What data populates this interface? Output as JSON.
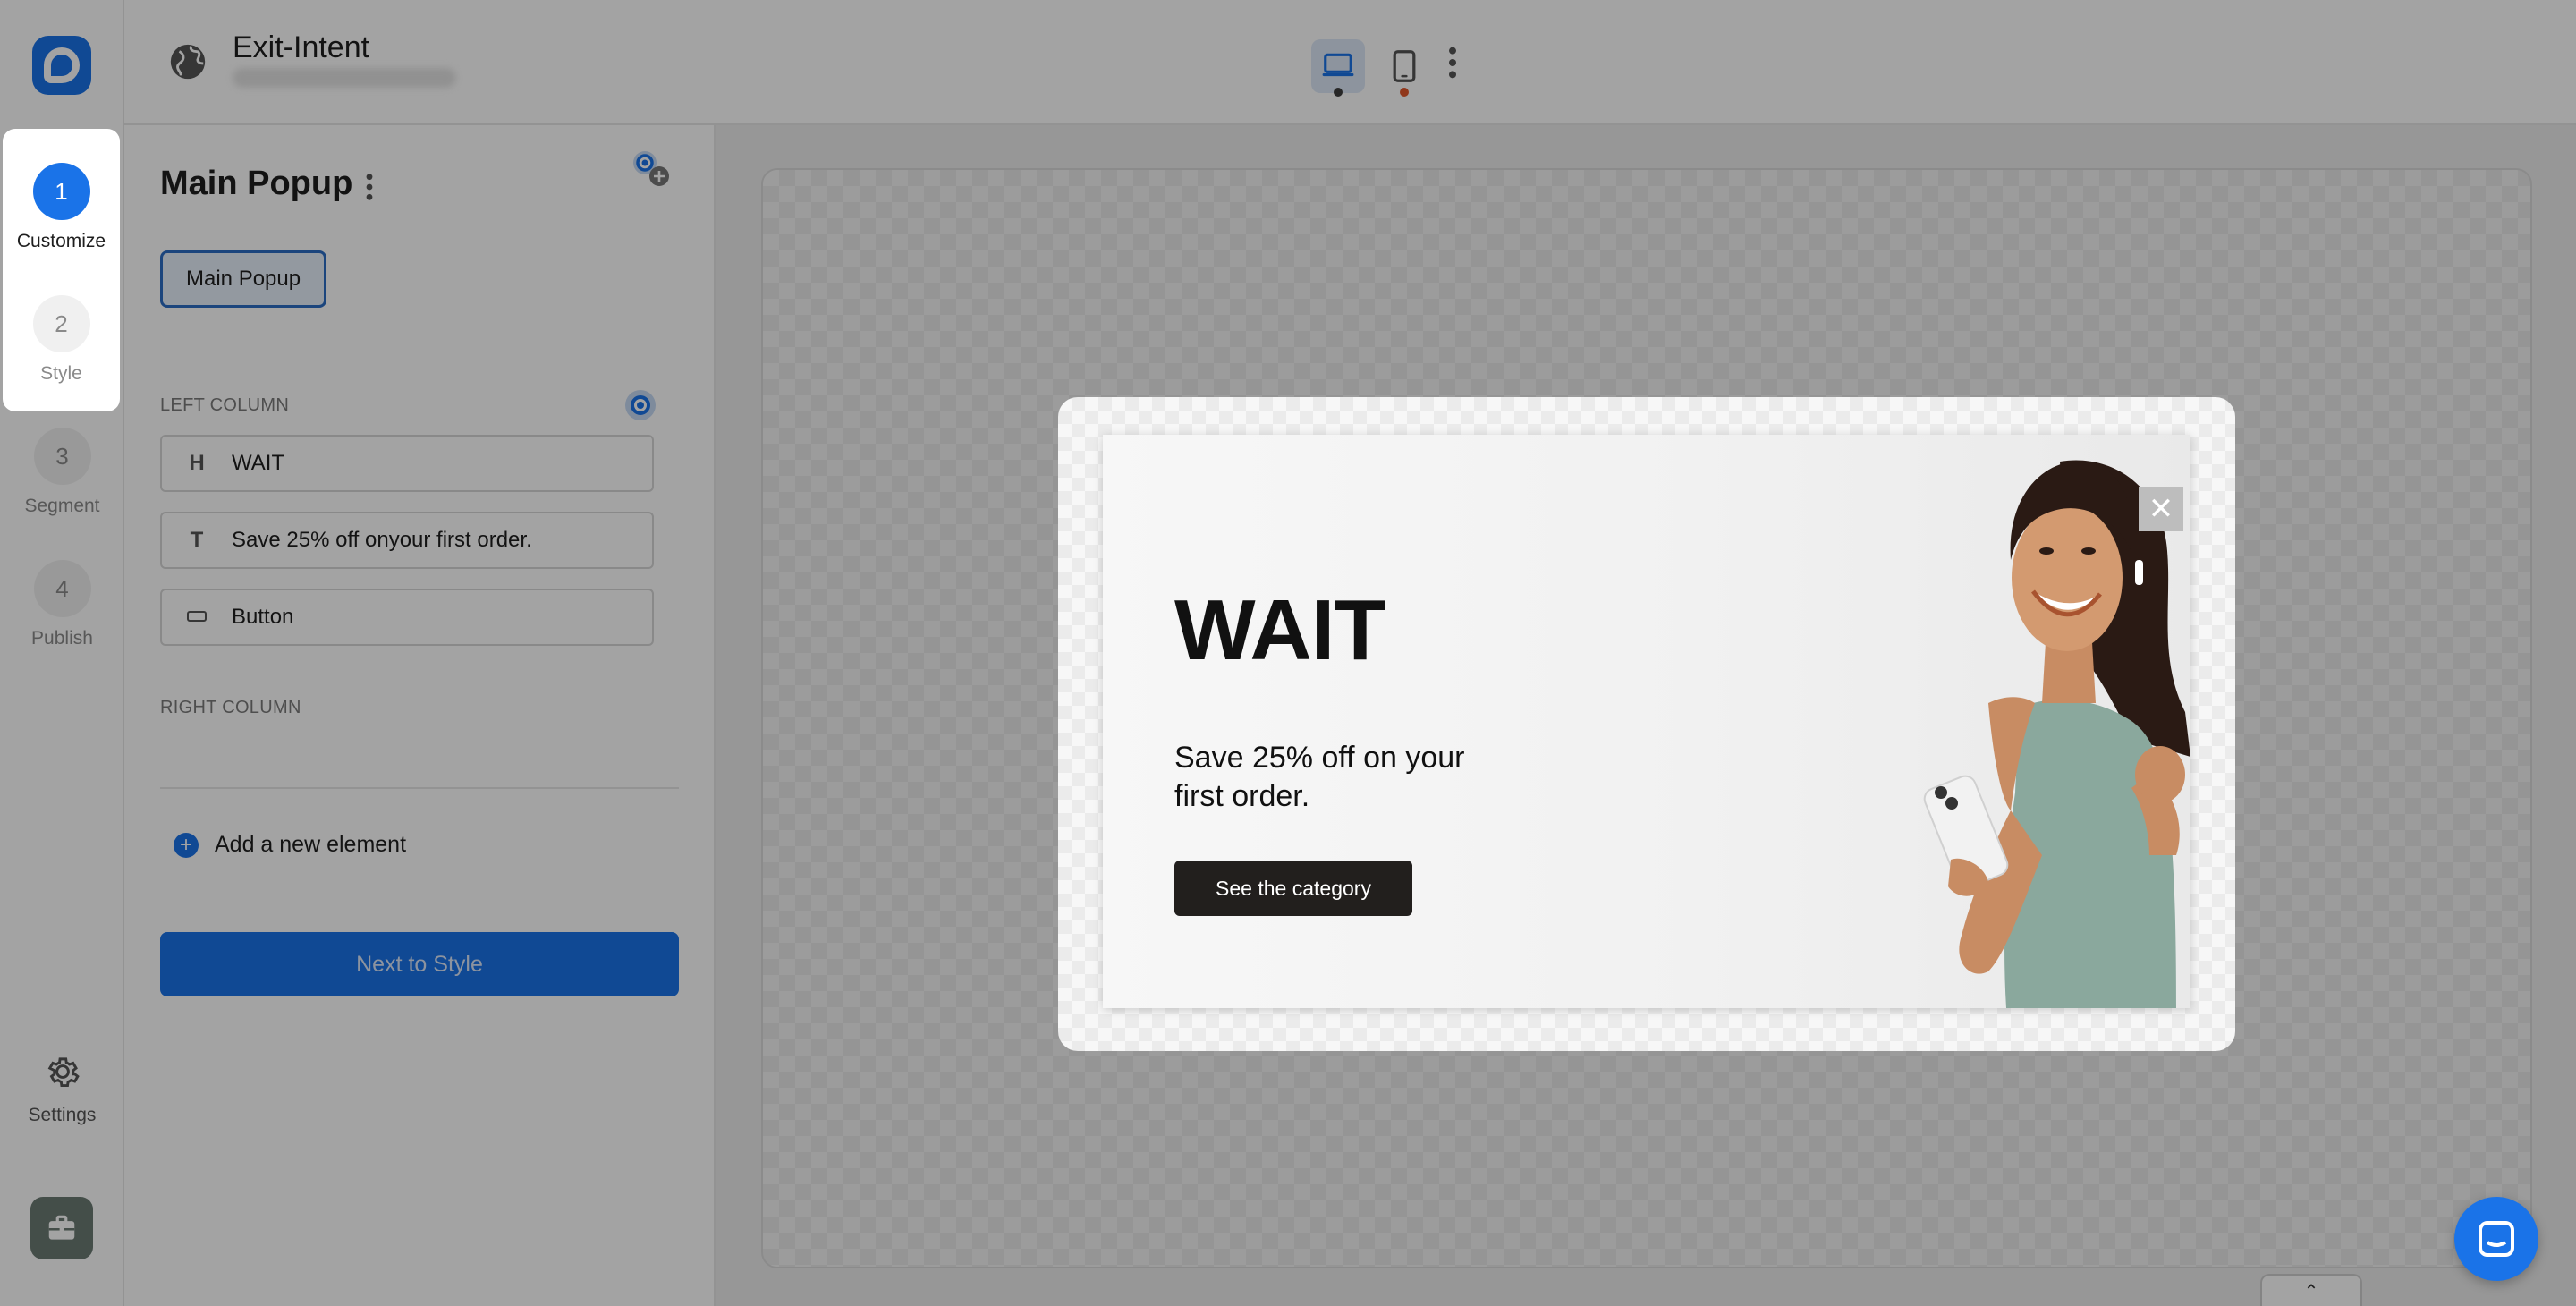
{
  "app": {
    "campaign_title": "Exit-Intent"
  },
  "steps": [
    {
      "num": "1",
      "label": "Customize"
    },
    {
      "num": "2",
      "label": "Style"
    },
    {
      "num": "3",
      "label": "Segment"
    },
    {
      "num": "4",
      "label": "Publish"
    }
  ],
  "sidebar": {
    "settings_label": "Settings"
  },
  "topbar": {
    "devices": [
      "desktop-icon",
      "mobile-icon"
    ],
    "active_device": "desktop"
  },
  "panel": {
    "title": "Main Popup",
    "variant_tag": "Main Popup",
    "left_column_label": "LEFT COLUMN",
    "right_column_label": "RIGHT COLUMN",
    "elements": [
      {
        "icon": "H",
        "label": "WAIT"
      },
      {
        "icon": "T",
        "label": "Save 25% off onyour first order."
      },
      {
        "icon": "button-icon",
        "label": "Button"
      }
    ],
    "add_element_label": "Add a new element",
    "next_button_label": "Next to Style"
  },
  "popup": {
    "heading": "WAIT",
    "text": "Save 25% off on your first order.",
    "cta_label": "See the category",
    "close_glyph": "✕"
  },
  "colors": {
    "accent": "#1a73e8",
    "overlay": "rgba(0,0,0,0.36)",
    "cta_bg": "#221f1d"
  }
}
